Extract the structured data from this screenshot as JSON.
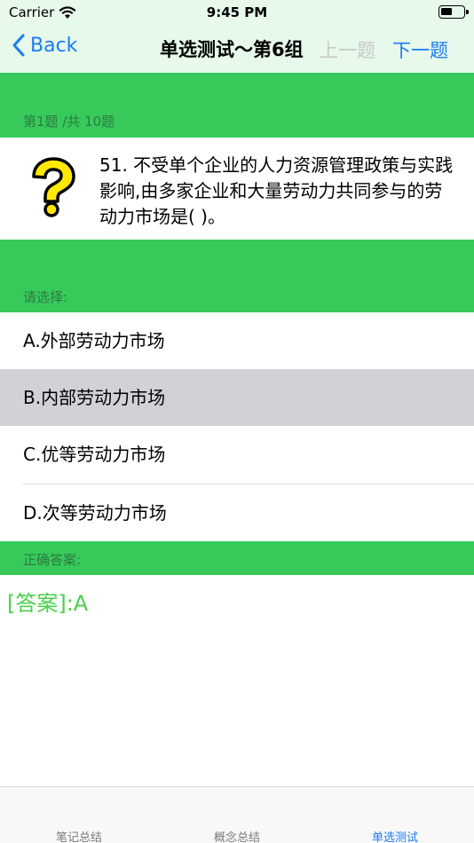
{
  "status": {
    "carrier": "Carrier",
    "time": "9:45 PM"
  },
  "nav": {
    "back": "Back",
    "title": "单选测试～第6组",
    "prev": "上一题",
    "next": "下一题"
  },
  "question": {
    "progress": "第1题 /共 10题",
    "text": "51. 不受单个企业的人力资源管理政策与实践影响,由多家企业和大量劳动力共同参与的劳动力市场是( )。",
    "icon": "question-mark-icon"
  },
  "options": {
    "label": "请选择:",
    "items": [
      {
        "text": "A.外部劳动力市场"
      },
      {
        "text": "B.内部劳动力市场"
      },
      {
        "text": "C.优等劳动力市场"
      },
      {
        "text": "D.次等劳动力市场"
      }
    ],
    "selected": "B.内部劳动力市场"
  },
  "answer": {
    "label": "正确答案:",
    "text": "[答案]:A"
  },
  "tabs": [
    {
      "label": "笔记总结"
    },
    {
      "label": "概念总结"
    },
    {
      "label": "单选测试"
    }
  ],
  "colors": {
    "accent": "#1a7cf5",
    "band": "#37ca5b",
    "answer": "#48d14a",
    "selected_row": "#d1d1d6"
  }
}
